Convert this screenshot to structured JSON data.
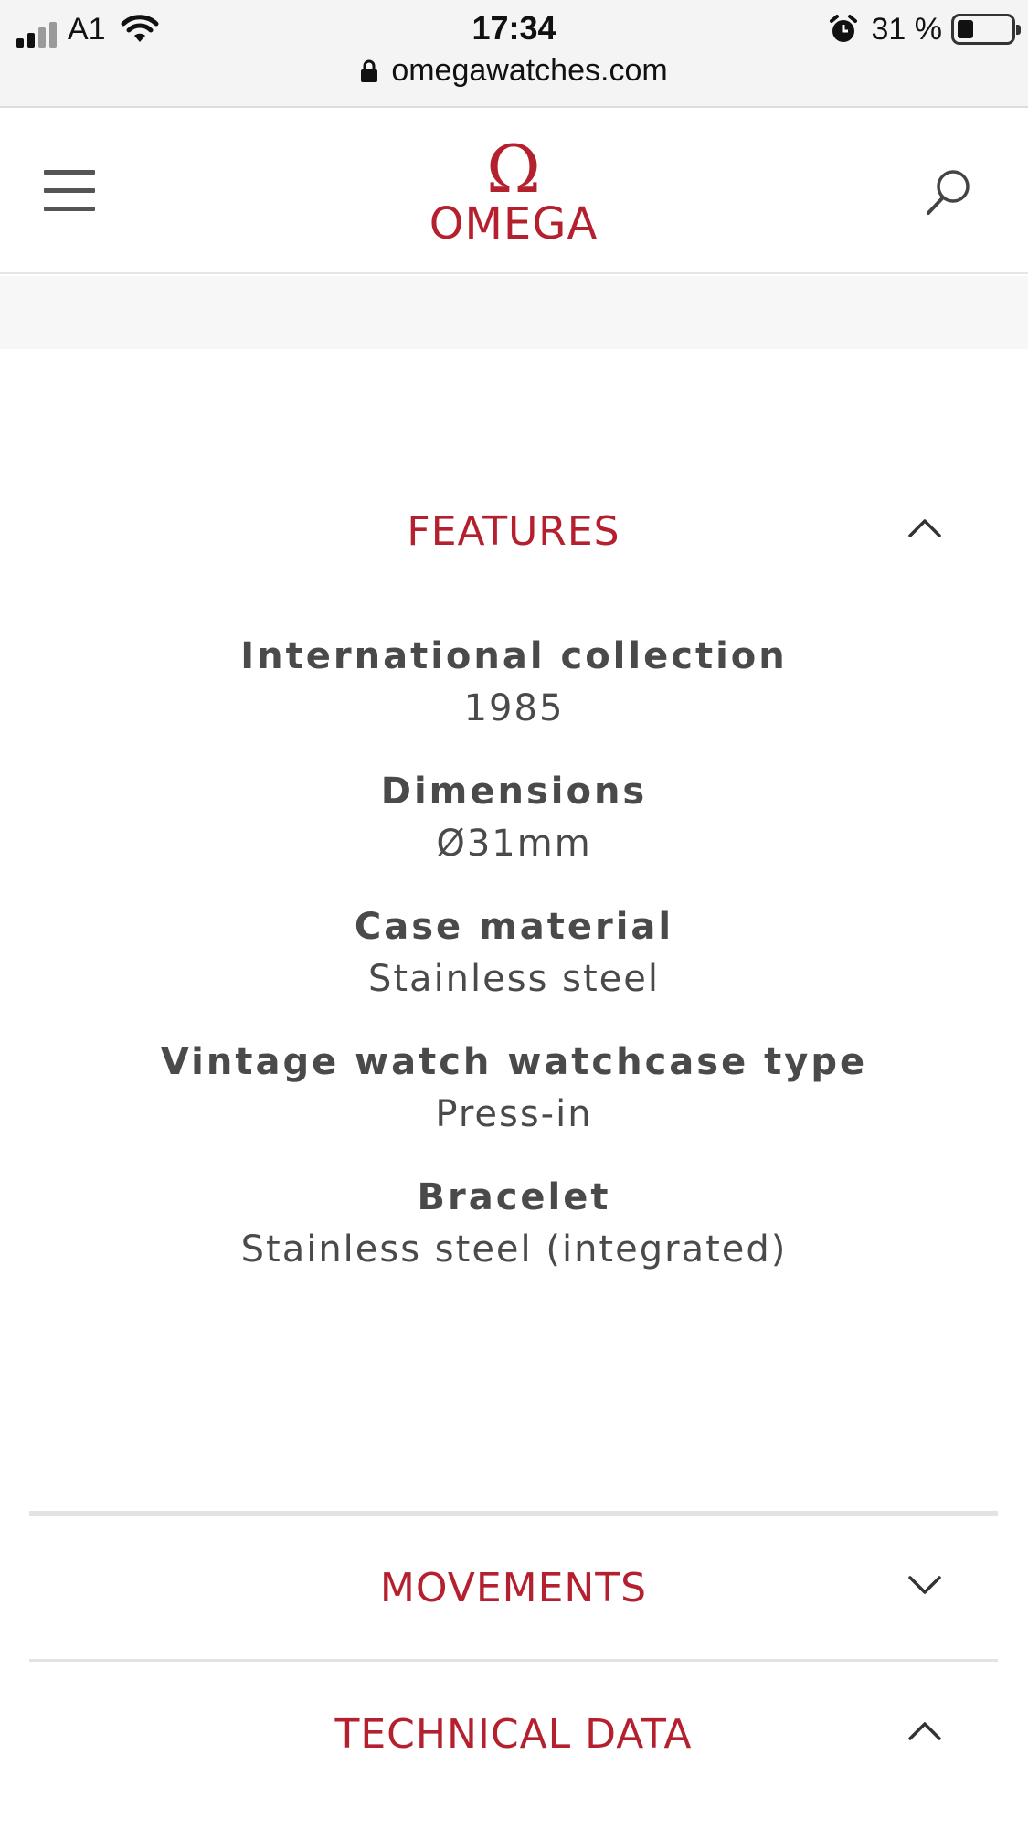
{
  "status_bar": {
    "carrier": "A1",
    "time": "17:34",
    "battery_percent": "31 %",
    "battery_level": 0.31,
    "url": "omegawatches.com"
  },
  "header": {
    "logo_symbol": "Ω",
    "logo_text": "OMEGA"
  },
  "sections": {
    "features": {
      "title": "FEATURES",
      "expanded": true,
      "items": [
        {
          "label": "International collection",
          "value": "1985"
        },
        {
          "label": "Dimensions",
          "value": "Ø31mm"
        },
        {
          "label": "Case material",
          "value": "Stainless steel"
        },
        {
          "label": "Vintage watch watchcase type",
          "value": "Press-in"
        },
        {
          "label": "Bracelet",
          "value": "Stainless steel (integrated)"
        }
      ]
    },
    "movements": {
      "title": "MOVEMENTS",
      "expanded": false
    },
    "technical_data": {
      "title": "TECHNICAL DATA",
      "expanded": true
    }
  },
  "colors": {
    "brand_red": "#b5202e",
    "text_grey": "#4a4a4a"
  },
  "icons": {
    "menu": "hamburger-menu-icon",
    "search": "search-icon",
    "lock": "lock-icon",
    "expand": "chevron-down-icon",
    "collapse": "chevron-up-icon"
  }
}
